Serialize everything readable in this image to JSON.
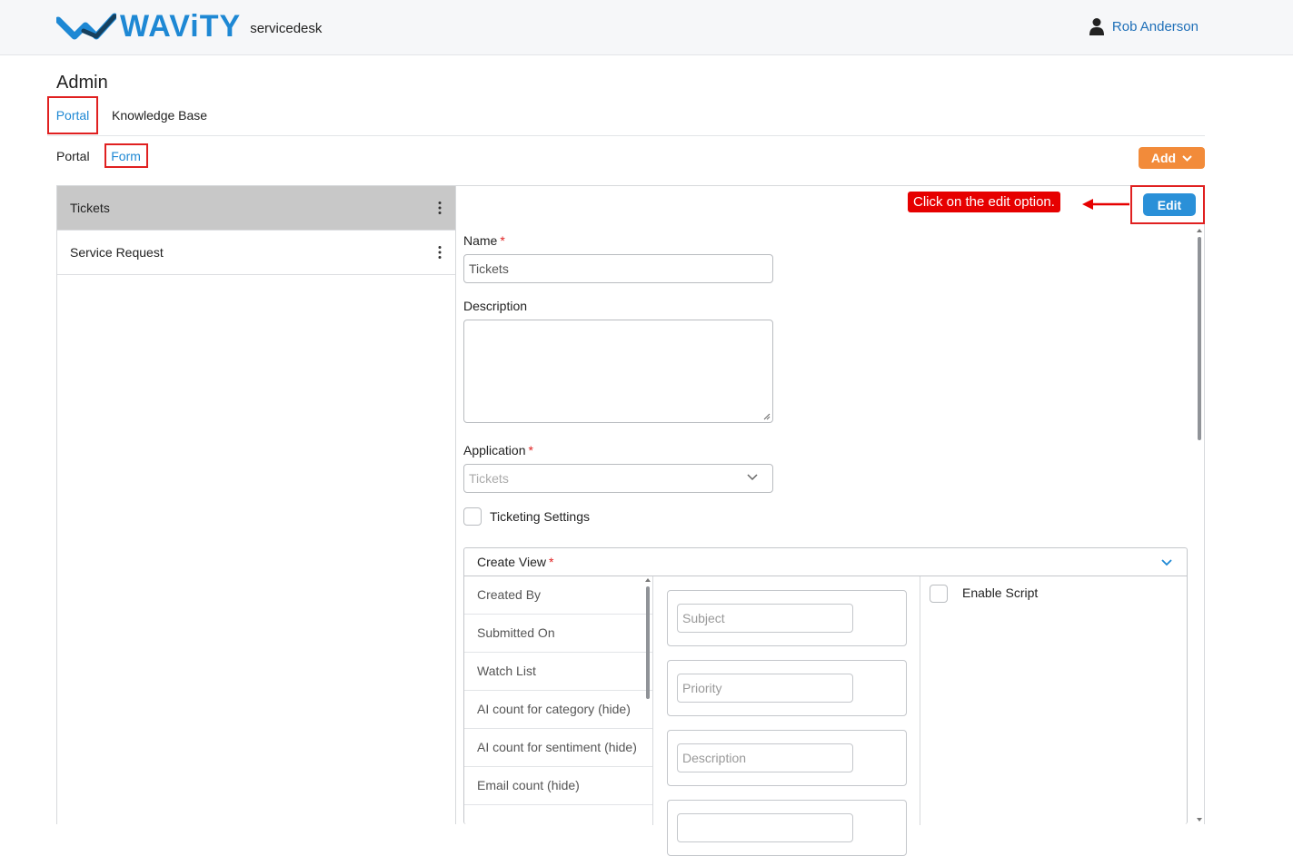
{
  "header": {
    "logo_text": "WAViTY",
    "app_name": "servicedesk",
    "user_name": "Rob Anderson"
  },
  "page_title": "Admin",
  "primary_tabs": [
    {
      "label": "Portal",
      "selected": true
    },
    {
      "label": "Knowledge Base",
      "selected": false
    }
  ],
  "secondary_tabs": [
    {
      "label": "Portal",
      "selected": false
    },
    {
      "label": "Form",
      "selected": true
    }
  ],
  "add_button": {
    "label": "Add",
    "color": "#f28b3a"
  },
  "forms_list": [
    {
      "label": "Tickets",
      "selected": true
    },
    {
      "label": "Service Request",
      "selected": false
    }
  ],
  "annotation": {
    "callout_text": "Click on the edit option."
  },
  "edit_button": {
    "label": "Edit",
    "color": "#2a90d8"
  },
  "form": {
    "name_label": "Name",
    "name_value": "Tickets",
    "description_label": "Description",
    "description_value": "",
    "application_label": "Application",
    "application_value": "Tickets",
    "ticketing_settings_label": "Ticketing Settings",
    "ticketing_settings_checked": false
  },
  "create_view": {
    "title": "Create View",
    "available_fields": [
      "Created By",
      "Submitted On",
      "Watch List",
      "AI count for category (hide)",
      "AI count for sentiment (hide)",
      "Email count (hide)"
    ],
    "selected_fields": [
      "Subject",
      "Priority",
      "Description",
      ""
    ],
    "enable_script_label": "Enable Script",
    "enable_script_checked": false
  },
  "colors": {
    "accent": "#1e88d4",
    "highlight_border": "#e02020"
  }
}
